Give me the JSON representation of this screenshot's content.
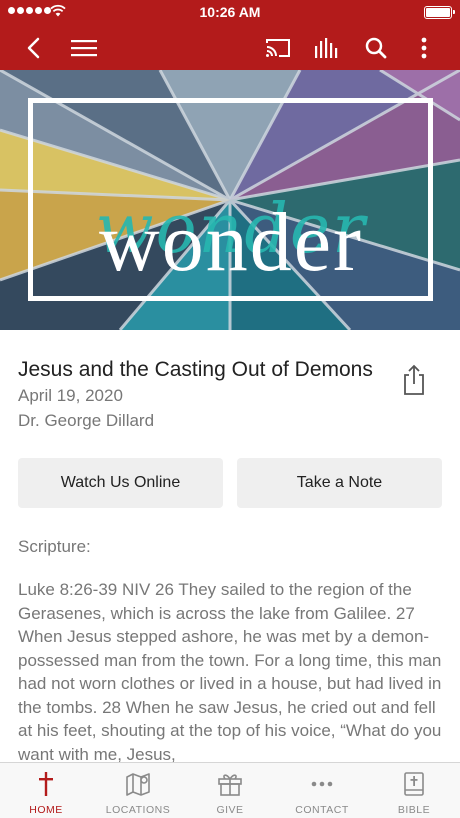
{
  "status_bar": {
    "time": "10:26 AM"
  },
  "nav": {
    "icons": [
      "back-icon",
      "menu-icon",
      "cast-icon",
      "audio-icon",
      "search-icon",
      "more-icon"
    ]
  },
  "hero": {
    "title": "wonder",
    "script": "wonder"
  },
  "sermon": {
    "title": "Jesus and the Casting Out of Demons",
    "date": "April 19, 2020",
    "speaker": "Dr. George Dillard"
  },
  "actions": {
    "watch_label": "Watch Us Online",
    "note_label": "Take a Note"
  },
  "scripture": {
    "label": "Scripture:",
    "text": "Luke 8:26-39 NIV 26 They sailed to the region of the Gerasenes, which is across the lake from Galilee. 27 When Jesus stepped ashore, he was met by a demon-possessed man from the town. For a long time, this man had not worn clothes or lived in a house, but had lived in the tombs. 28 When he saw Jesus, he cried out and fell at his feet, shouting at the top of his voice, “What do you want with me, Jesus,"
  },
  "tabs": [
    {
      "label": "HOME",
      "icon": "cross-icon",
      "active": true
    },
    {
      "label": "LOCATIONS",
      "icon": "map-icon",
      "active": false
    },
    {
      "label": "GIVE",
      "icon": "gift-icon",
      "active": false
    },
    {
      "label": "CONTACT",
      "icon": "more-dots-icon",
      "active": false
    },
    {
      "label": "BIBLE",
      "icon": "bible-icon",
      "active": false
    }
  ],
  "colors": {
    "brand": "#b31b1b",
    "teal": "#27b7b0",
    "text_muted": "#777777"
  }
}
